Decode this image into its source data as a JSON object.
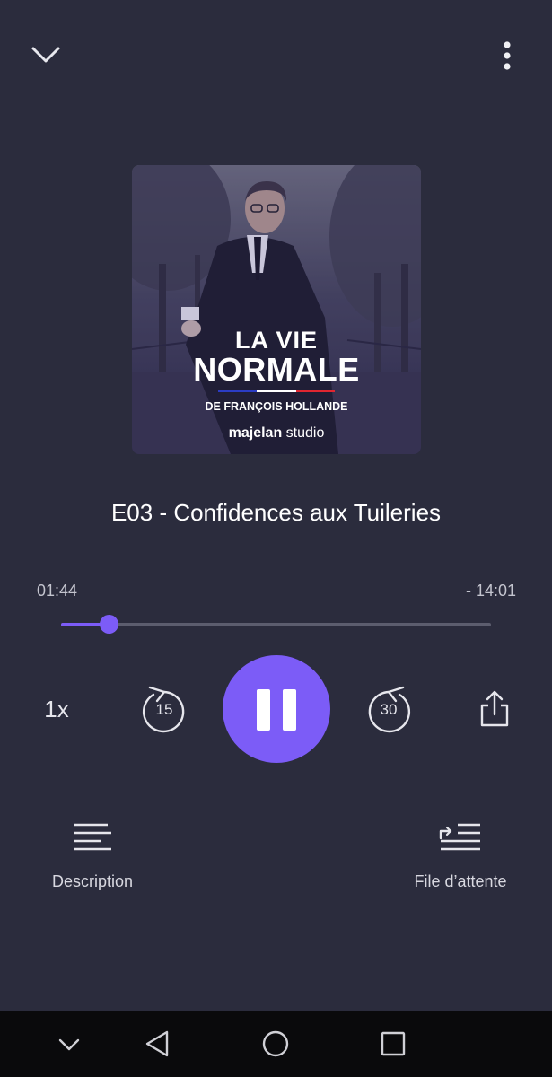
{
  "player": {
    "episode_title": "E03 - Confidences aux Tuileries",
    "time_elapsed": "01:44",
    "time_remaining": "- 14:01",
    "progress_fraction": 0.11,
    "speed_label": "1x",
    "rewind_seconds": "15",
    "forward_seconds": "30",
    "state": "playing"
  },
  "cover": {
    "title_line1": "LA VIE",
    "title_line2": "NORMALE",
    "subtitle": "DE FRANÇOIS HOLLANDE",
    "brand_bold": "majelan",
    "brand_regular": " studio",
    "flag_colors": [
      "#2b3cc4",
      "#ffffff",
      "#e02630"
    ]
  },
  "actions": {
    "description_label": "Description",
    "queue_label": "File d’attente"
  },
  "icons": {
    "collapse": "chevron-down-icon",
    "more": "more-vertical-icon",
    "rewind": "rewind-15-icon",
    "forward": "forward-30-icon",
    "share": "share-icon",
    "description": "description-lines-icon",
    "queue": "queue-icon"
  },
  "colors": {
    "background": "#2b2c3d",
    "accent": "#7c5cf7",
    "track": "#5c5d6e",
    "nav_bar": "#0a0a0c"
  }
}
